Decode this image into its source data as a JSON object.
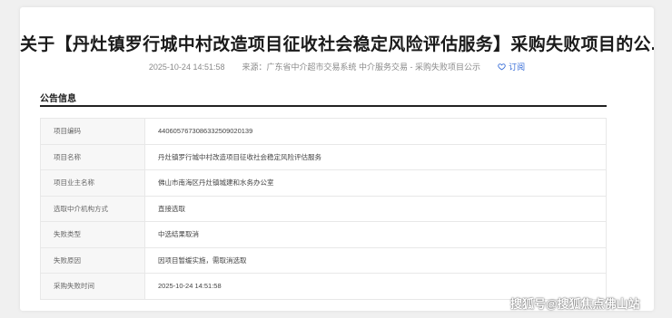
{
  "announcement": {
    "title": "关于【丹灶镇罗行城中村改造项目征收社会稳定风险评估服务】采购失败项目的公...",
    "meta": {
      "datetime": "2025-10-24 14:51:58",
      "source_label": "来源：",
      "source": "广东省中介超市交易系统 中介服务交易 - 采购失败项目公示",
      "subscribe_label": "订阅",
      "subscribe_icon": "heart-icon"
    }
  },
  "section": {
    "title": "公告信息"
  },
  "info_rows": [
    {
      "key": "项目编码",
      "value": "440605767308633250902013​9"
    },
    {
      "key": "项目名称",
      "value": "丹灶镇罗行城中村改造项目征收社会稳定风险评估服务"
    },
    {
      "key": "项目业主名称",
      "value": "佛山市南海区丹灶镇城建和水务办公室"
    },
    {
      "key": "选取中介机构方式",
      "value": "直接选取"
    },
    {
      "key": "失败类型",
      "value": "中选结果取消"
    },
    {
      "key": "失败原因",
      "value": "因项目暂缓实施，需取消选取"
    },
    {
      "key": "采购失败时间",
      "value": "2025-10-24 14:51:58"
    }
  ],
  "watermark": "搜狐号@搜狐焦点佛山站",
  "colors": {
    "accent": "#3a6fd8",
    "rule": "#222222",
    "key_bg": "#f7f7f7"
  }
}
